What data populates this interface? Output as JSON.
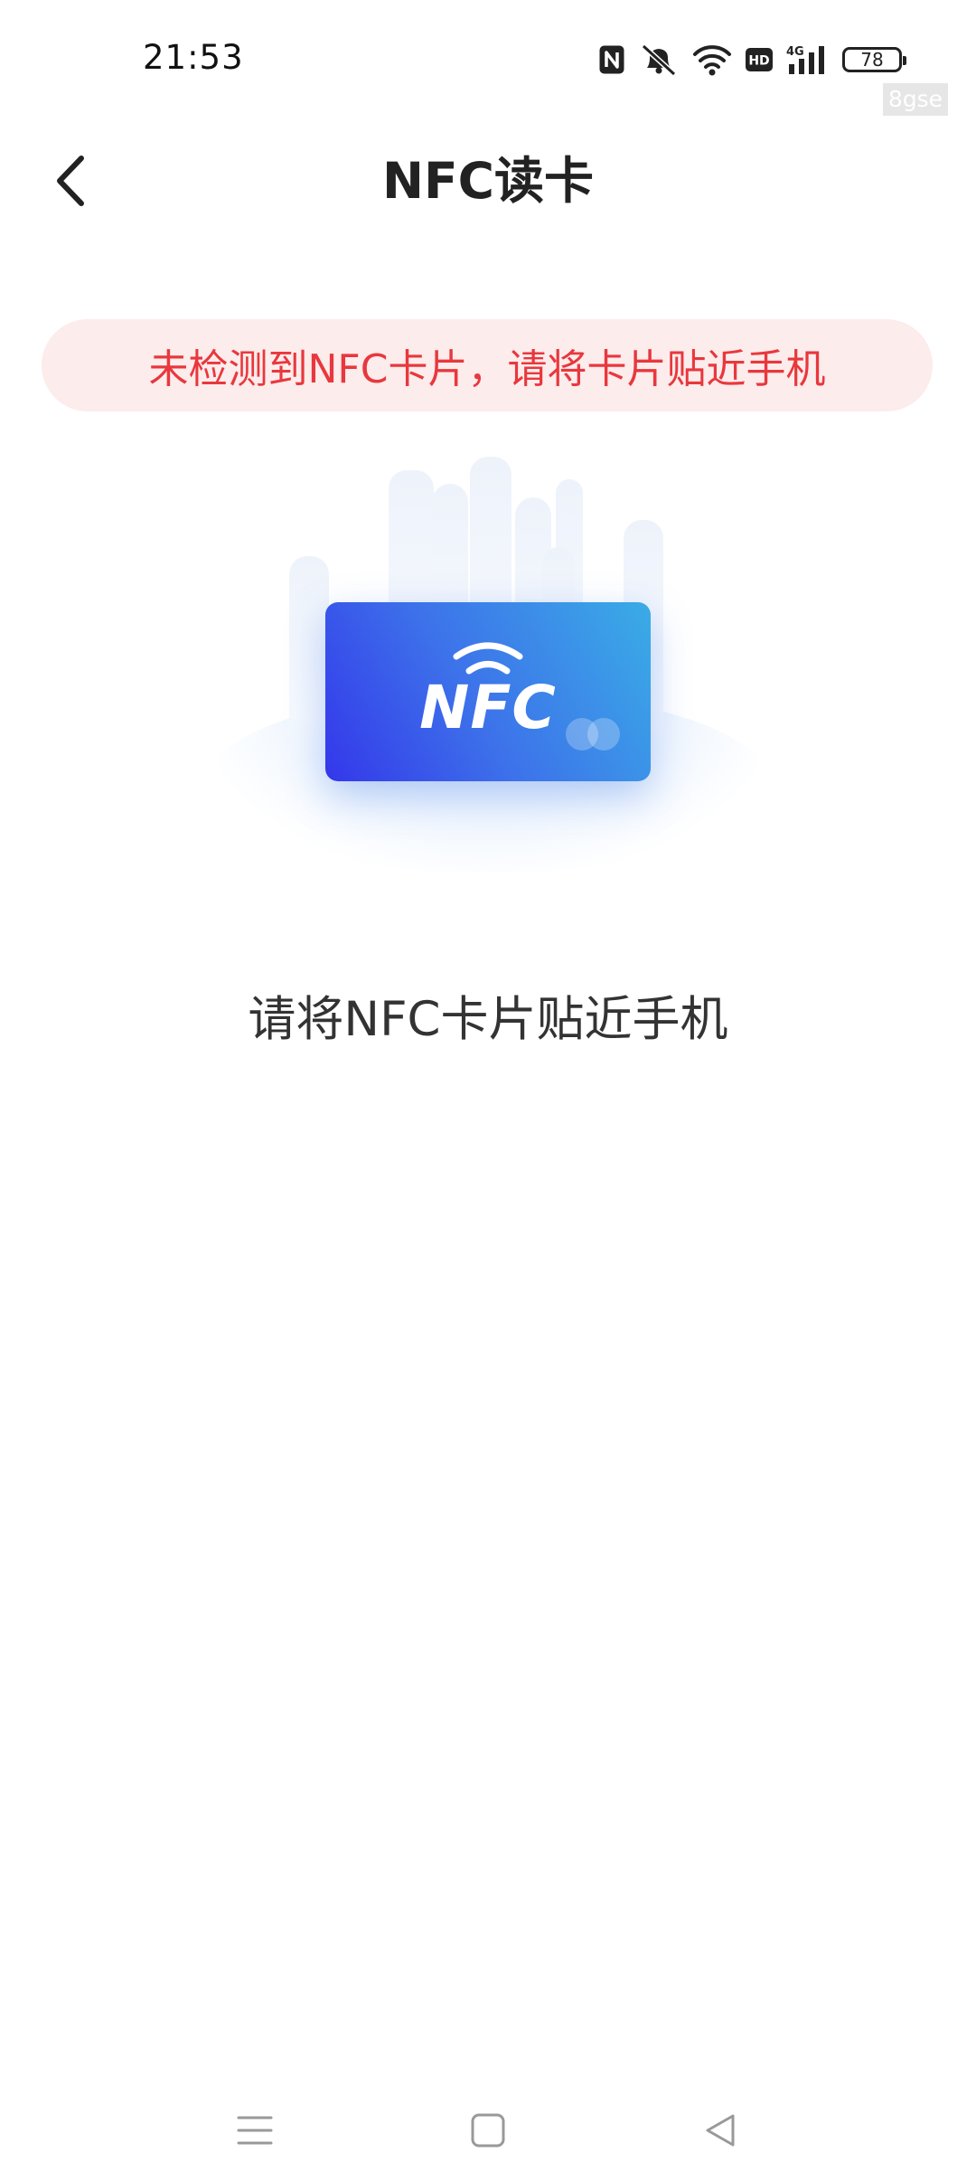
{
  "status_bar": {
    "time": "21:53",
    "battery_level": "78",
    "icons": [
      "nfc-icon",
      "mute-icon",
      "wifi-icon",
      "hd-icon",
      "signal-4g-icon",
      "battery-icon"
    ]
  },
  "watermark": "8gse",
  "header": {
    "back_icon": "chevron-left-icon",
    "title": "NFC读卡"
  },
  "alert": {
    "text": "未检测到NFC卡片，请将卡片贴近手机",
    "color": "#e8383d",
    "background": "#fdecec"
  },
  "card": {
    "label": "NFC",
    "icon": "nfc-waves-icon"
  },
  "instruction": "请将NFC卡片贴近手机",
  "nav_bar": {
    "icons": [
      "menu-icon",
      "home-icon",
      "back-triangle-icon"
    ]
  }
}
